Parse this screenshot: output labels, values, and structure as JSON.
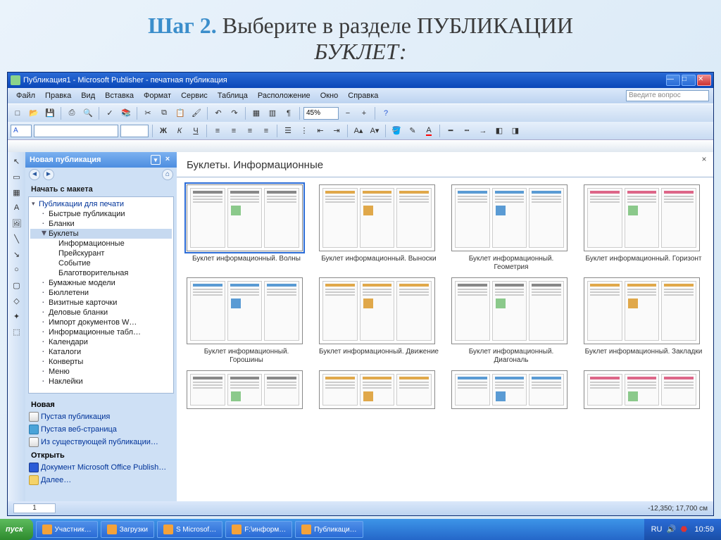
{
  "slide": {
    "step": "Шаг 2.",
    "rest": " Выберите в разделе ПУБЛИКАЦИИ",
    "line2": "БУКЛЕТ:"
  },
  "window": {
    "title": "Публикация1 - Microsoft Publisher - печатная публикация"
  },
  "menu": {
    "file": "Файл",
    "edit": "Правка",
    "view": "Вид",
    "insert": "Вставка",
    "format": "Формат",
    "tools": "Сервис",
    "table": "Таблица",
    "arrange": "Расположение",
    "window": "Окно",
    "help": "Справка",
    "help_search_placeholder": "Введите вопрос"
  },
  "toolbar": {
    "zoom": "45%"
  },
  "taskpane": {
    "title": "Новая публикация",
    "section_start": "Начать с макета",
    "tree": [
      {
        "label": "Публикации для печати",
        "lvl": 0,
        "expand": true
      },
      {
        "label": "Быстрые публикации",
        "lvl": 1
      },
      {
        "label": "Бланки",
        "lvl": 1
      },
      {
        "label": "Буклеты",
        "lvl": 1,
        "selected": true,
        "expand": true
      },
      {
        "label": "Информационные",
        "lvl": 2
      },
      {
        "label": "Прейскурант",
        "lvl": 2
      },
      {
        "label": "Событие",
        "lvl": 2
      },
      {
        "label": "Благотворительная",
        "lvl": 2
      },
      {
        "label": "Бумажные модели",
        "lvl": 1
      },
      {
        "label": "Бюллетени",
        "lvl": 1
      },
      {
        "label": "Визитные карточки",
        "lvl": 1
      },
      {
        "label": "Деловые бланки",
        "lvl": 1
      },
      {
        "label": "Импорт документов W…",
        "lvl": 1
      },
      {
        "label": "Информационные табл…",
        "lvl": 1
      },
      {
        "label": "Календари",
        "lvl": 1
      },
      {
        "label": "Каталоги",
        "lvl": 1
      },
      {
        "label": "Конверты",
        "lvl": 1
      },
      {
        "label": "Меню",
        "lvl": 1
      },
      {
        "label": "Наклейки",
        "lvl": 1
      }
    ],
    "section_new": "Новая",
    "link_blank": "Пустая публикация",
    "link_web": "Пустая веб-страница",
    "link_existing": "Из существующей публикации…",
    "section_open": "Открыть",
    "link_recent": "Документ Microsoft Office Publish…",
    "link_more": "Далее…"
  },
  "gallery": {
    "heading": "Буклеты. Информационные",
    "items": [
      {
        "label": "Буклет информационный. Волны",
        "selected": true,
        "accent": "gr"
      },
      {
        "label": "Буклет информационный. Выноски",
        "accent": "or"
      },
      {
        "label": "Буклет информационный. Геометрия",
        "accent": "bl"
      },
      {
        "label": "Буклет информационный. Горизонт",
        "accent": "pk"
      },
      {
        "label": "Буклет информационный. Горошины",
        "accent": "bl"
      },
      {
        "label": "Буклет информационный. Движение",
        "accent": "or"
      },
      {
        "label": "Буклет информационный. Диагональ",
        "accent": "gr"
      },
      {
        "label": "Буклет информационный. Закладки",
        "accent": "or"
      }
    ]
  },
  "statusbar": {
    "page": "1",
    "coords": "-12,350; 17,700 см"
  },
  "taskbar": {
    "start": "пуск",
    "items": [
      "Участник…",
      "Загрузки",
      "S Microsof…",
      "F:\\информ…",
      "Публикаци…"
    ],
    "lang": "RU",
    "time": "10:59"
  }
}
